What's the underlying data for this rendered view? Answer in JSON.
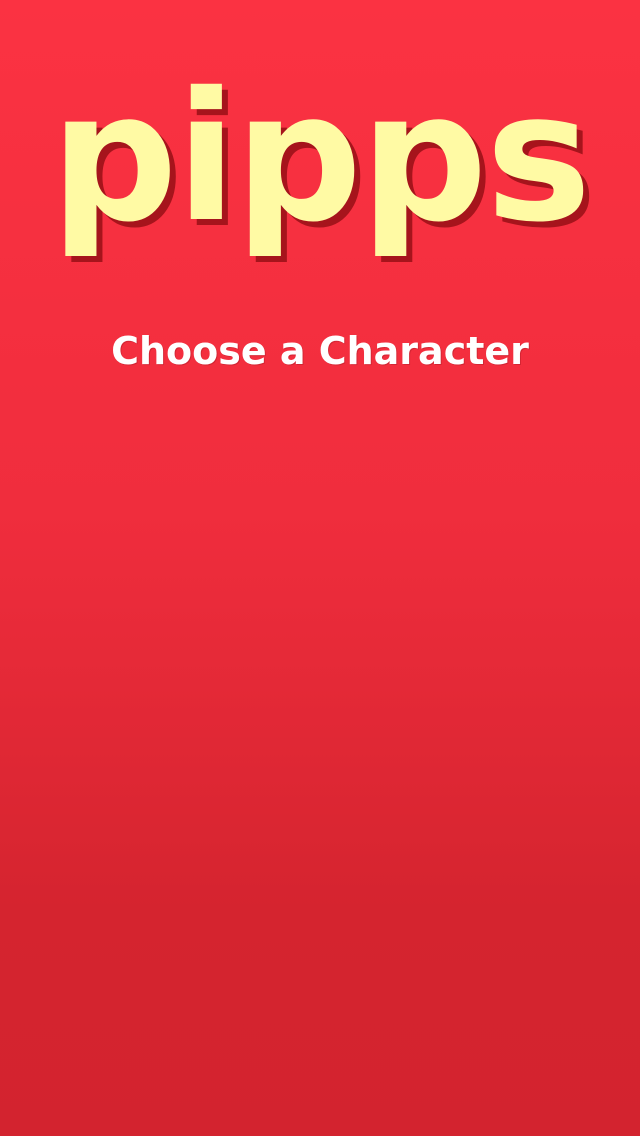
{
  "app": {
    "logo_text": "pipps",
    "subtitle": "Choose a Character"
  },
  "colors": {
    "background_top": "#fb3242",
    "background_bottom": "#d3232f",
    "logo": "#fffaa4",
    "logo_shadow": "#a6141c",
    "subtitle": "#ffffff"
  }
}
